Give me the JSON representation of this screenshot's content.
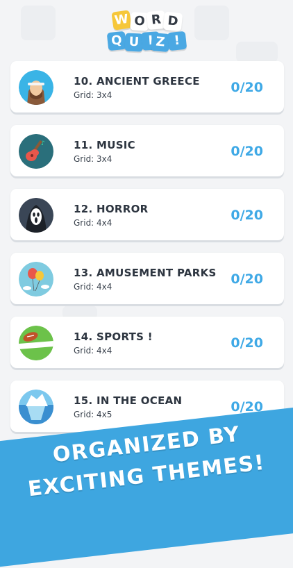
{
  "logo": {
    "word": [
      "W",
      "O",
      "R",
      "D"
    ],
    "quiz": [
      "Q",
      "U",
      "I",
      "Z",
      "!"
    ],
    "colors": {
      "yellow": "#f6c73a",
      "blue": "#4aa8e3",
      "white": "#ffffff"
    }
  },
  "levels": [
    {
      "title": "10. ANCIENT GREECE",
      "grid": "Grid: 3x4",
      "score": "0/20",
      "icon": "greek-man-icon"
    },
    {
      "title": "11. MUSIC",
      "grid": "Grid: 3x4",
      "score": "0/20",
      "icon": "guitar-icon"
    },
    {
      "title": "12. HORROR",
      "grid": "Grid: 4x4",
      "score": "0/20",
      "icon": "ghost-mask-icon"
    },
    {
      "title": "13. AMUSEMENT PARKS",
      "grid": "Grid: 4x4",
      "score": "0/20",
      "icon": "balloons-icon"
    },
    {
      "title": "14. SPORTS !",
      "grid": "Grid: 4x4",
      "score": "0/20",
      "icon": "football-icon"
    },
    {
      "title": "15. IN THE OCEAN",
      "grid": "Grid: 4x5",
      "score": "0/20",
      "icon": "iceberg-icon"
    }
  ],
  "banner": {
    "line1": "ORGANIZED BY",
    "line2": "EXCITING THEMES!",
    "color": "#3ea6e0"
  },
  "accent": "#3fa9e6"
}
